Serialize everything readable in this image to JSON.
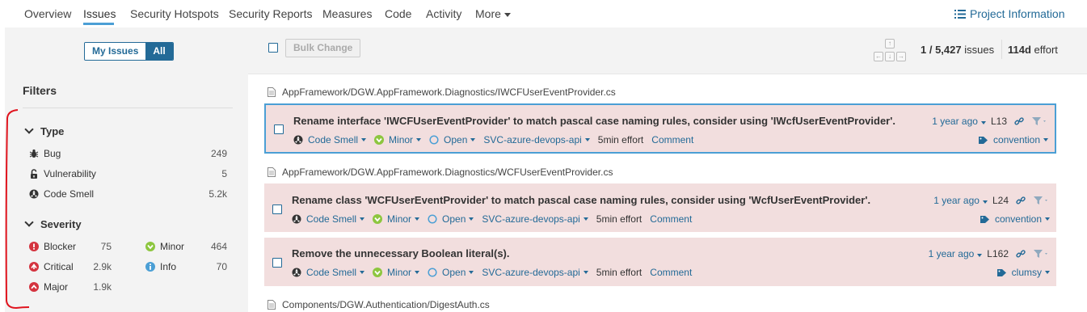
{
  "nav": {
    "items": [
      "Overview",
      "Issues",
      "Security Hotspots",
      "Security Reports",
      "Measures",
      "Code",
      "Activity",
      "More"
    ],
    "project_info": "Project Information"
  },
  "sidebar": {
    "toggle": {
      "my_issues": "My Issues",
      "all": "All",
      "selected": "All"
    },
    "filters_title": "Filters",
    "type": {
      "title": "Type",
      "items": [
        {
          "label": "Bug",
          "count": "249",
          "icon": "bug-icon"
        },
        {
          "label": "Vulnerability",
          "count": "5",
          "icon": "lock-icon"
        },
        {
          "label": "Code Smell",
          "count": "5.2k",
          "icon": "code-smell-icon"
        }
      ]
    },
    "severity": {
      "title": "Severity",
      "items": [
        {
          "label": "Blocker",
          "count": "75",
          "icon": "blocker-icon",
          "color": "#d4333f"
        },
        {
          "label": "Minor",
          "count": "464",
          "icon": "minor-icon",
          "color": "#8dc63f"
        },
        {
          "label": "Critical",
          "count": "2.9k",
          "icon": "critical-icon",
          "color": "#d4333f"
        },
        {
          "label": "Info",
          "count": "70",
          "icon": "info-icon",
          "color": "#4b9fd5"
        },
        {
          "label": "Major",
          "count": "1.9k",
          "icon": "major-icon",
          "color": "#d4333f"
        }
      ]
    }
  },
  "toolbar": {
    "bulk_change": "Bulk Change",
    "issues_current": "1",
    "issues_sep": " / ",
    "issues_total": "5,427",
    "issues_word": " issues",
    "effort_value": "114d",
    "effort_word": " effort"
  },
  "files": [
    "AppFramework/DGW.AppFramework.Diagnostics/IWCFUserEventProvider.cs",
    "AppFramework/DGW.AppFramework.Diagnostics/WCFUserEventProvider.cs",
    "Components/DGW.Authentication/DigestAuth.cs"
  ],
  "issues": [
    {
      "message": "Rename interface 'IWCFUserEventProvider' to match pascal case naming rules, consider using 'IWcfUserEventProvider'.",
      "type": "Code Smell",
      "severity": "Minor",
      "status": "Open",
      "assignee": "SVC-azure-devops-api",
      "effort": "5min effort",
      "comment": "Comment",
      "age": "1 year ago",
      "line": "L13",
      "tag": "convention"
    },
    {
      "message": "Rename class 'WCFUserEventProvider' to match pascal case naming rules, consider using 'WcfUserEventProvider'.",
      "type": "Code Smell",
      "severity": "Minor",
      "status": "Open",
      "assignee": "SVC-azure-devops-api",
      "effort": "5min effort",
      "comment": "Comment",
      "age": "1 year ago",
      "line": "L24",
      "tag": "convention"
    },
    {
      "message": "Remove the unnecessary Boolean literal(s).",
      "type": "Code Smell",
      "severity": "Minor",
      "status": "Open",
      "assignee": "SVC-azure-devops-api",
      "effort": "5min effort",
      "comment": "Comment",
      "age": "1 year ago",
      "line": "L162",
      "tag": "clumsy"
    }
  ],
  "colors": {
    "accent": "#236a97",
    "issue_bg": "#f2dede",
    "selected_border": "#4b9fd5",
    "annotation": "#e0141e"
  }
}
